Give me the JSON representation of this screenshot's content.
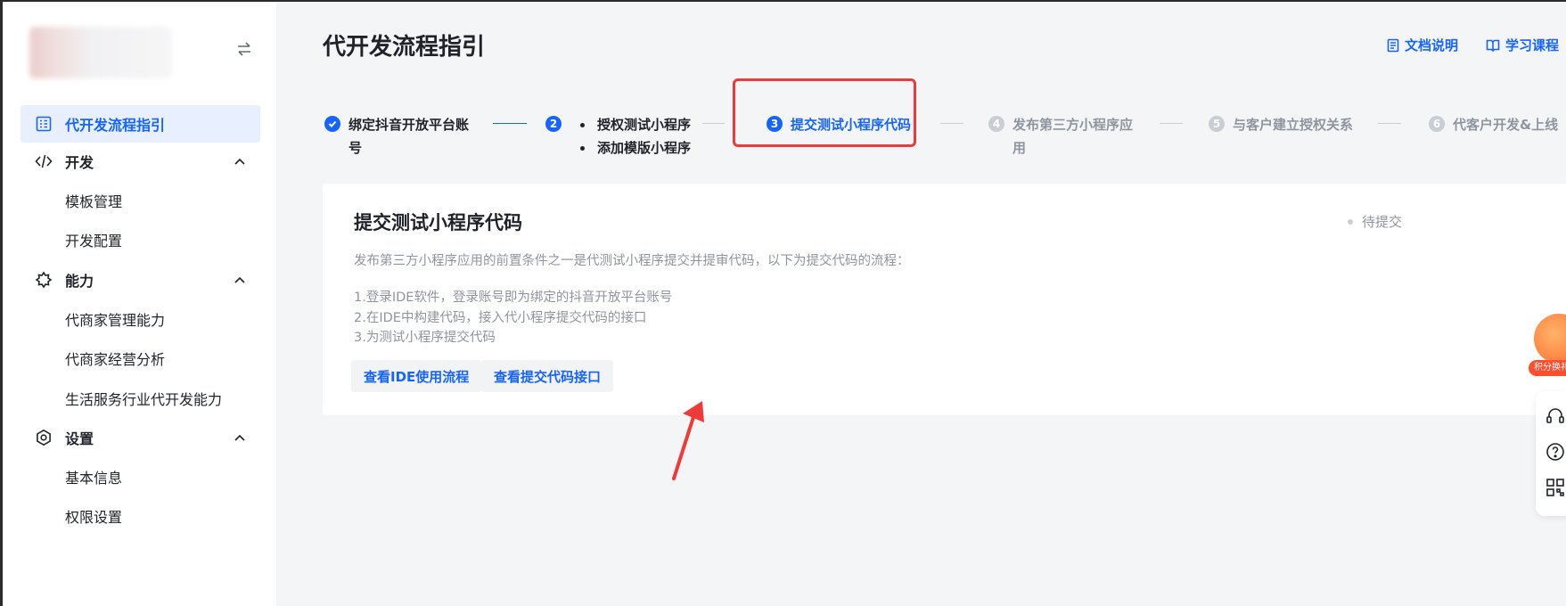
{
  "sidebar": {
    "nav": [
      {
        "label": "代开发流程指引",
        "icon": "list-board-icon",
        "active": true
      },
      {
        "label": "开发",
        "icon": "code-icon",
        "expanded": true
      },
      {
        "label": "模板管理",
        "sub": true
      },
      {
        "label": "开发配置",
        "sub": true
      },
      {
        "label": "能力",
        "icon": "ability-icon",
        "expanded": true
      },
      {
        "label": "代商家管理能力",
        "sub": true
      },
      {
        "label": "代商家经营分析",
        "sub": true
      },
      {
        "label": "生活服务行业代开发能力",
        "sub": true
      },
      {
        "label": "设置",
        "icon": "settings-icon",
        "expanded": true
      },
      {
        "label": "基本信息",
        "sub": true
      },
      {
        "label": "权限设置",
        "sub": true
      }
    ]
  },
  "header": {
    "title": "代开发流程指引",
    "links": [
      {
        "label": "文档说明",
        "icon": "document-icon"
      },
      {
        "label": "学习课程",
        "icon": "book-icon"
      }
    ]
  },
  "steps": [
    {
      "num": "✓",
      "label_line1": "绑定抖音开放平台账",
      "label_line2": "号",
      "state": "done"
    },
    {
      "num": "2",
      "bullets": [
        "授权测试小程序",
        "添加模版小程序"
      ],
      "state": "done"
    },
    {
      "num": "3",
      "label_line1": "提交测试小程序代码",
      "state": "current"
    },
    {
      "num": "4",
      "label_line1": "发布第三方小程序应",
      "label_line2": "用",
      "state": "pending"
    },
    {
      "num": "5",
      "label_line1": "与客户建立授权关系",
      "state": "pending"
    },
    {
      "num": "6",
      "label_line1": "代客户开发&上线",
      "state": "pending"
    }
  ],
  "card": {
    "title": "提交测试小程序代码",
    "status": "待提交",
    "description": "发布第三方小程序应用的前置条件之一是代测试小程序提交并提审代码，以下为提交代码的流程：",
    "steps": [
      "1.登录IDE软件，登录账号即为绑定的抖音开放平台账号",
      "2.在IDE中构建代码，接入代小程序提交代码的接口",
      "3.为测试小程序提交代码"
    ],
    "buttons": [
      {
        "label": "查看IDE使用流程"
      },
      {
        "label": "查看提交代码接口"
      }
    ]
  },
  "promo": {
    "tag": "积分换礼"
  },
  "colors": {
    "accent": "#1664ff",
    "highlight": "#ef3a3a",
    "muted": "#8f959e"
  }
}
